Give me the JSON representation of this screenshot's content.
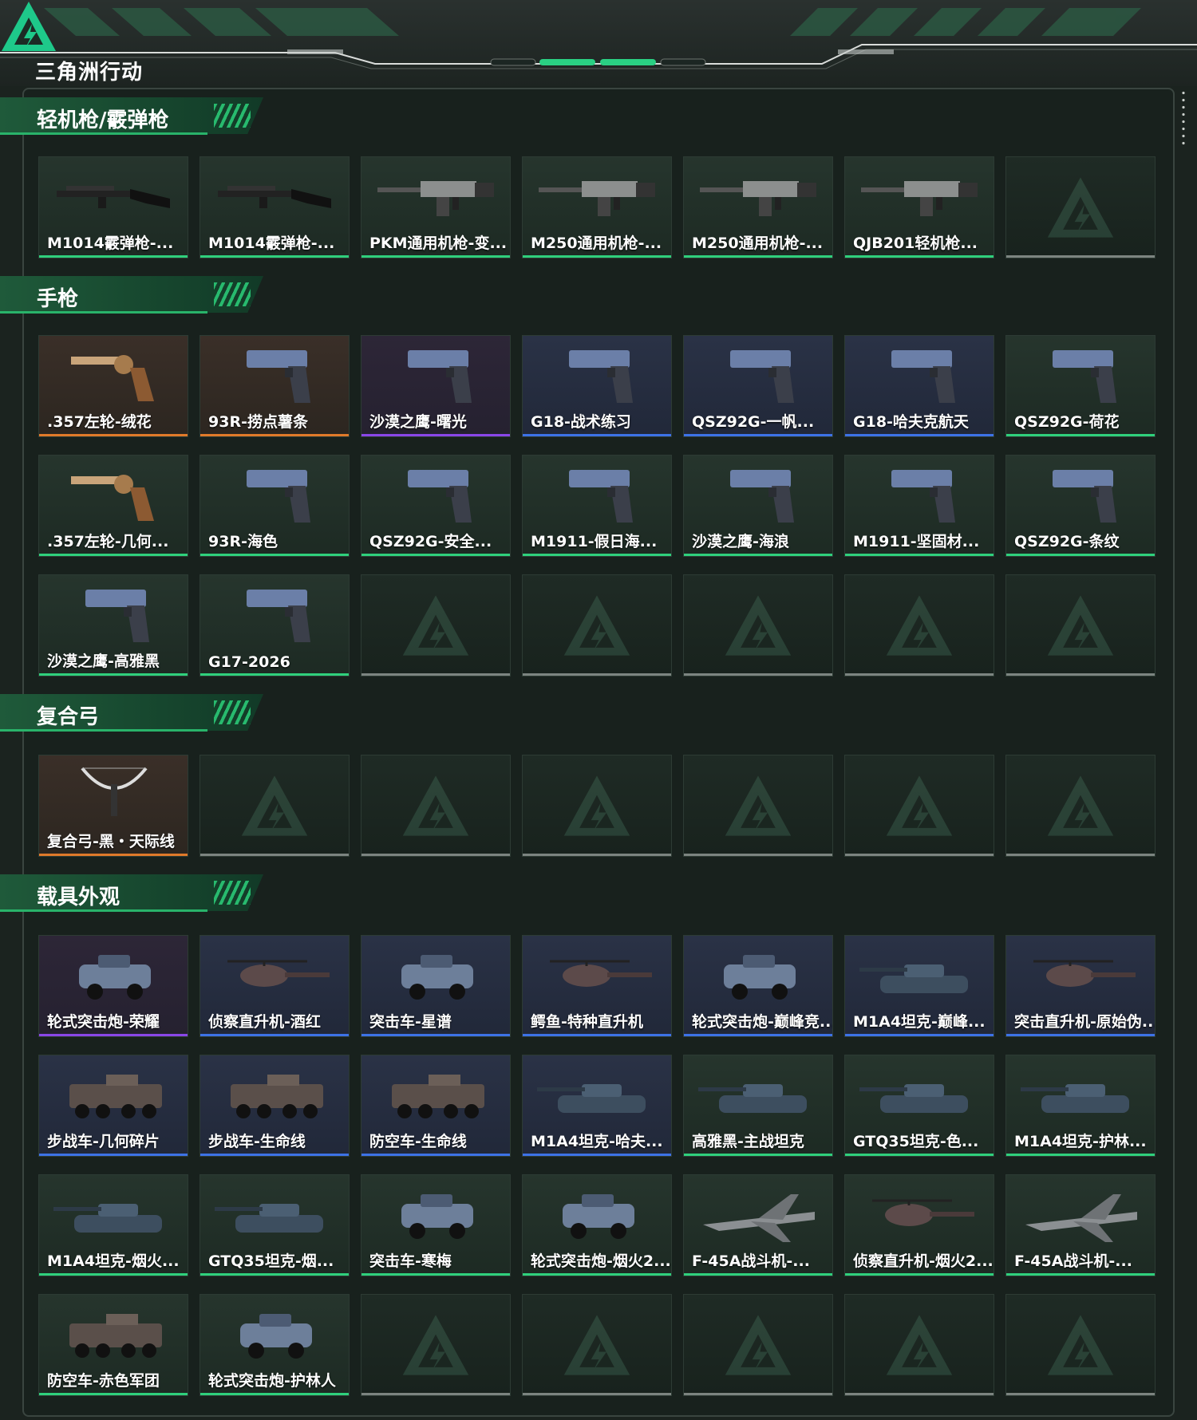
{
  "app": {
    "logo_text": "三角洲行动"
  },
  "colors": {
    "green": "#2fd07c",
    "orange": "#e07a2a",
    "purple": "#8a46e8",
    "blue": "#3d72e6"
  },
  "sections": [
    {
      "title": "轻机枪/霰弹枪",
      "rows": [
        [
          {
            "name": "M1014霰弹枪-...",
            "rarity": "g",
            "icon": "shotgun"
          },
          {
            "name": "M1014霰弹枪-...",
            "rarity": "g",
            "icon": "shotgun"
          },
          {
            "name": "PKM通用机枪-变...",
            "rarity": "g",
            "icon": "mg"
          },
          {
            "name": "M250通用机枪-...",
            "rarity": "g",
            "icon": "mg"
          },
          {
            "name": "M250通用机枪-...",
            "rarity": "g",
            "icon": "mg"
          },
          {
            "name": "QJB201轻机枪...",
            "rarity": "g",
            "icon": "mg"
          },
          null
        ]
      ]
    },
    {
      "title": "手枪",
      "rows": [
        [
          {
            "name": ".357左轮-绒花",
            "rarity": "o",
            "icon": "revolver"
          },
          {
            "name": "93R-捞点薯条",
            "rarity": "o",
            "icon": "pistol"
          },
          {
            "name": "沙漠之鹰-曙光",
            "rarity": "p",
            "icon": "pistol"
          },
          {
            "name": "G18-战术练习",
            "rarity": "b",
            "icon": "pistol"
          },
          {
            "name": "QSZ92G-一帆...",
            "rarity": "b",
            "icon": "pistol"
          },
          {
            "name": "G18-哈夫克航天",
            "rarity": "b",
            "icon": "pistol"
          },
          {
            "name": "QSZ92G-荷花",
            "rarity": "g",
            "icon": "pistol"
          }
        ],
        [
          {
            "name": ".357左轮-几何...",
            "rarity": "g",
            "icon": "revolver"
          },
          {
            "name": "93R-海色",
            "rarity": "g",
            "icon": "pistol"
          },
          {
            "name": "QSZ92G-安全...",
            "rarity": "g",
            "icon": "pistol"
          },
          {
            "name": "M1911-假日海...",
            "rarity": "g",
            "icon": "pistol"
          },
          {
            "name": "沙漠之鹰-海浪",
            "rarity": "g",
            "icon": "pistol"
          },
          {
            "name": "M1911-坚固材...",
            "rarity": "g",
            "icon": "pistol"
          },
          {
            "name": "QSZ92G-条纹",
            "rarity": "g",
            "icon": "pistol"
          }
        ],
        [
          {
            "name": "沙漠之鹰-高雅黑",
            "rarity": "g",
            "icon": "pistol"
          },
          {
            "name": "G17-2026",
            "rarity": "g",
            "icon": "pistol"
          },
          null,
          null,
          null,
          null,
          null
        ]
      ]
    },
    {
      "title": "复合弓",
      "rows": [
        [
          {
            "name": "复合弓-黑・天际线",
            "rarity": "o",
            "icon": "bow"
          },
          null,
          null,
          null,
          null,
          null,
          null
        ]
      ]
    },
    {
      "title": "载具外观",
      "rows": [
        [
          {
            "name": "轮式突击炮-荣耀",
            "rarity": "p",
            "icon": "car"
          },
          {
            "name": "侦察直升机-酒红",
            "rarity": "b",
            "icon": "heli"
          },
          {
            "name": "突击车-星谱",
            "rarity": "b",
            "icon": "car"
          },
          {
            "name": "鳄鱼-特种直升机",
            "rarity": "b",
            "icon": "heli"
          },
          {
            "name": "轮式突击炮-巅峰竞...",
            "rarity": "b",
            "icon": "car"
          },
          {
            "name": "M1A4坦克-巅峰...",
            "rarity": "b",
            "icon": "tank"
          },
          {
            "name": "突击直升机-原始伪...",
            "rarity": "b",
            "icon": "heli"
          }
        ],
        [
          {
            "name": "步战车-几何碎片",
            "rarity": "b",
            "icon": "ifv"
          },
          {
            "name": "步战车-生命线",
            "rarity": "b",
            "icon": "ifv"
          },
          {
            "name": "防空车-生命线",
            "rarity": "b",
            "icon": "ifv"
          },
          {
            "name": "M1A4坦克-哈夫...",
            "rarity": "b",
            "icon": "tank"
          },
          {
            "name": "高雅黑-主战坦克",
            "rarity": "g",
            "icon": "tank"
          },
          {
            "name": "GTQ35坦克-色...",
            "rarity": "g",
            "icon": "tank"
          },
          {
            "name": "M1A4坦克-护林...",
            "rarity": "g",
            "icon": "tank"
          }
        ],
        [
          {
            "name": "M1A4坦克-烟火...",
            "rarity": "g",
            "icon": "tank"
          },
          {
            "name": "GTQ35坦克-烟...",
            "rarity": "g",
            "icon": "tank"
          },
          {
            "name": "突击车-寒梅",
            "rarity": "g",
            "icon": "car"
          },
          {
            "name": "轮式突击炮-烟火2...",
            "rarity": "g",
            "icon": "car"
          },
          {
            "name": "F-45A战斗机-...",
            "rarity": "g",
            "icon": "jet"
          },
          {
            "name": "侦察直升机-烟火2...",
            "rarity": "g",
            "icon": "heli"
          },
          {
            "name": "F-45A战斗机-...",
            "rarity": "g",
            "icon": "jet"
          }
        ],
        [
          {
            "name": "防空车-赤色军团",
            "rarity": "g",
            "icon": "ifv"
          },
          {
            "name": "轮式突击炮-护林人",
            "rarity": "g",
            "icon": "car"
          },
          null,
          null,
          null,
          null,
          null
        ]
      ]
    }
  ]
}
